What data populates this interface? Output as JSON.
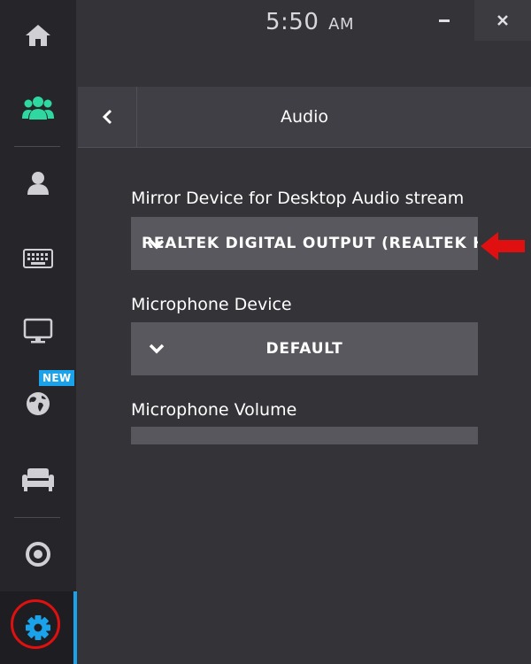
{
  "window": {
    "clock_time": "5:50",
    "clock_ampm": "AM",
    "minimize_label": "–",
    "close_label": "×"
  },
  "sidebar": {
    "items": [
      {
        "icon": "home-icon"
      },
      {
        "icon": "friends-icon",
        "color": "#2ed8a0"
      },
      {
        "icon": "profile-icon"
      },
      {
        "icon": "keyboard-icon"
      },
      {
        "icon": "display-icon"
      },
      {
        "icon": "globe-icon"
      },
      {
        "icon": "sofa-icon"
      },
      {
        "icon": "record-icon"
      },
      {
        "icon": "gear-icon",
        "color": "#1aa3ea",
        "selected": true
      }
    ],
    "new_badge": "NEW"
  },
  "header": {
    "back_icon": "chevron-left-icon",
    "title": "Audio"
  },
  "audio": {
    "mirror_label": "Mirror Device for Desktop Audio stream",
    "mirror_value": "REALTEK DIGITAL OUTPUT (REALTEK H",
    "mic_label": "Microphone Device",
    "mic_value": "DEFAULT",
    "volume_label": "Microphone Volume"
  },
  "colors": {
    "accent": "#1aa3ea",
    "friends": "#2ed8a0",
    "annotation_red": "#e01010"
  }
}
